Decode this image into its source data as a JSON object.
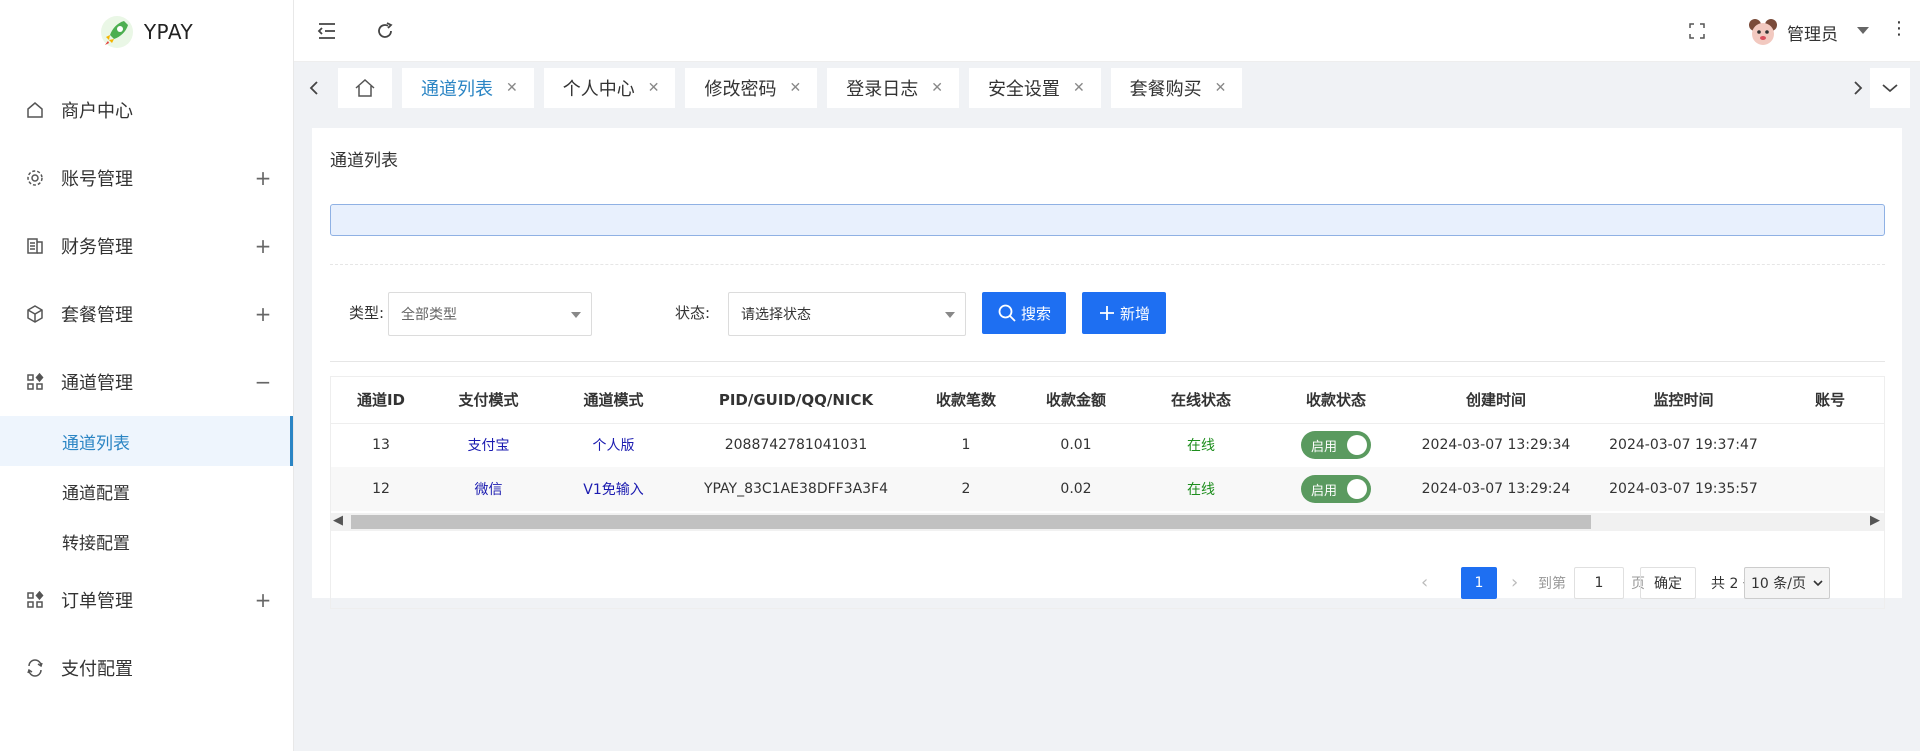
{
  "app": {
    "name": "YPAY"
  },
  "sidebar": {
    "items": [
      {
        "label": "商户中心",
        "icon": "home-icon"
      },
      {
        "label": "账号管理",
        "icon": "gear-icon",
        "sign": "+"
      },
      {
        "label": "财务管理",
        "icon": "finance-icon",
        "sign": "+"
      },
      {
        "label": "套餐管理",
        "icon": "package-icon",
        "sign": "+"
      },
      {
        "label": "通道管理",
        "icon": "apps-icon",
        "sign": "−"
      },
      {
        "label": "订单管理",
        "icon": "apps-icon",
        "sign": "+"
      },
      {
        "label": "支付配置",
        "icon": "payment-icon"
      }
    ],
    "subitems": [
      {
        "label": "通道列表",
        "active": true
      },
      {
        "label": "通道配置"
      },
      {
        "label": "转接配置"
      }
    ]
  },
  "header": {
    "user": "管理员"
  },
  "tabs": [
    {
      "label": "通道列表",
      "active": true
    },
    {
      "label": "个人中心"
    },
    {
      "label": "修改密码"
    },
    {
      "label": "登录日志"
    },
    {
      "label": "安全设置"
    },
    {
      "label": "套餐购买"
    }
  ],
  "main": {
    "title": "通道列表",
    "filters": {
      "type_label": "类型:",
      "type_value": "全部类型",
      "status_label": "状态:",
      "status_value": "请选择状态",
      "search_label": "搜索",
      "add_label": "新增"
    },
    "table": {
      "columns": [
        "通道ID",
        "支付模式",
        "通道模式",
        "PID/GUID/QQ/NICK",
        "收款笔数",
        "收款金额",
        "在线状态",
        "收款状态",
        "创建时间",
        "监控时间",
        "账号"
      ],
      "rows": [
        {
          "id": "13",
          "pay_mode": "支付宝",
          "channel_mode": "个人版",
          "pid": "2088742781041031",
          "count": "1",
          "amount": "0.01",
          "online": "在线",
          "switch": "启用",
          "created": "2024-03-07 13:29:34",
          "monitored": "2024-03-07 19:37:47"
        },
        {
          "id": "12",
          "pay_mode": "微信",
          "channel_mode": "V1免输入",
          "pid": "YPAY_83C1AE38DFF3A3F4",
          "count": "2",
          "amount": "0.02",
          "online": "在线",
          "switch": "启用",
          "created": "2024-03-07 13:29:24",
          "monitored": "2024-03-07 19:35:57"
        }
      ]
    },
    "pagination": {
      "current_page": "1",
      "goto_label": "到第",
      "goto_value": "1",
      "page_suffix": "页",
      "confirm": "确定",
      "total": "共 2 条",
      "page_size": "10 条/页"
    }
  },
  "colors": {
    "primary": "#1e6ff2",
    "accent": "#2b85c4",
    "online": "#1e8e1e",
    "switch_on": "#5a9a5f"
  }
}
